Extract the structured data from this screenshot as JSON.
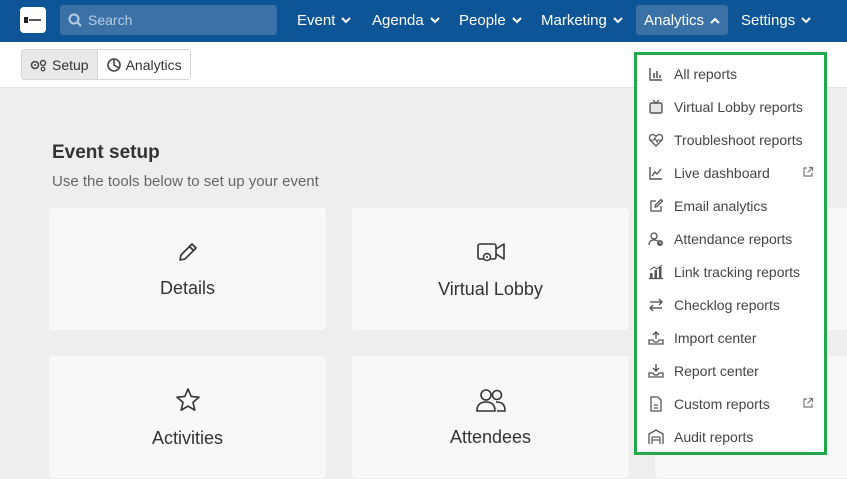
{
  "nav": {
    "search_placeholder": "Search",
    "items": [
      {
        "label": "Event"
      },
      {
        "label": "Agenda"
      },
      {
        "label": "People"
      },
      {
        "label": "Marketing"
      },
      {
        "label": "Analytics"
      },
      {
        "label": "Settings"
      }
    ]
  },
  "toolbar": {
    "setup_label": "Setup",
    "analytics_label": "Analytics"
  },
  "main": {
    "title": "Event setup",
    "subtitle": "Use the tools below to set up your event",
    "cards": [
      {
        "label": "Details",
        "icon": "pencil-icon"
      },
      {
        "label": "Virtual Lobby",
        "icon": "video-camera-icon"
      },
      {
        "label": "Activities",
        "icon": "star-icon"
      },
      {
        "label": "Attendees",
        "icon": "users-icon"
      }
    ]
  },
  "analytics_menu": {
    "items": [
      {
        "label": "All reports",
        "icon": "bar-chart-icon"
      },
      {
        "label": "Virtual Lobby reports",
        "icon": "tv-icon"
      },
      {
        "label": "Troubleshoot reports",
        "icon": "heart-pulse-icon"
      },
      {
        "label": "Live dashboard",
        "icon": "line-chart-icon",
        "external": true
      },
      {
        "label": "Email analytics",
        "icon": "edit-icon"
      },
      {
        "label": "Attendance reports",
        "icon": "user-clock-icon"
      },
      {
        "label": "Link tracking reports",
        "icon": "chart-bars-icon"
      },
      {
        "label": "Checklog reports",
        "icon": "swap-arrows-icon"
      },
      {
        "label": "Import center",
        "icon": "upload-icon"
      },
      {
        "label": "Report center",
        "icon": "download-icon"
      },
      {
        "label": "Custom reports",
        "icon": "document-icon",
        "external": true
      },
      {
        "label": "Audit reports",
        "icon": "warehouse-icon"
      }
    ]
  },
  "colors": {
    "nav_bg": "#0e5597",
    "highlight_border": "#20a84a"
  }
}
